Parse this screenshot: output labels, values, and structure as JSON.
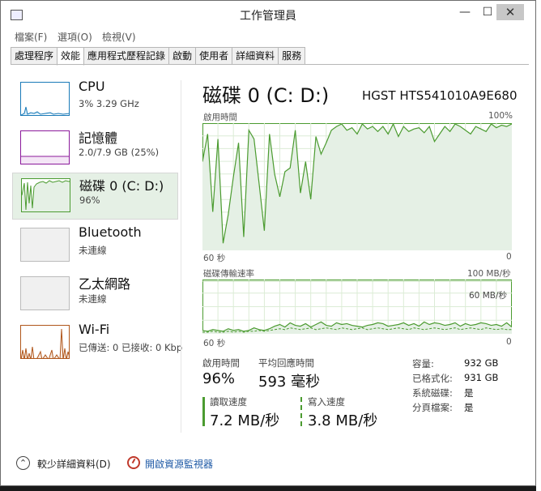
{
  "window": {
    "title": "工作管理員",
    "min": "—",
    "max": "☐",
    "close": "✕"
  },
  "menu": [
    "檔案(F)",
    "選項(O)",
    "檢視(V)"
  ],
  "tabs": [
    "處理程序",
    "效能",
    "應用程式歷程記錄",
    "啟動",
    "使用者",
    "詳細資料",
    "服務"
  ],
  "active_tab": 1,
  "sidebar": {
    "items": [
      {
        "title": "CPU",
        "sub": "3%  3.29 GHz",
        "color": "#1a7ab8"
      },
      {
        "title": "記憶體",
        "sub": "2.0/7.9 GB (25%)",
        "color": "#8b1a9b"
      },
      {
        "title": "磁碟 0 (C: D:)",
        "sub": "96%",
        "color": "#4b9b30"
      },
      {
        "title": "Bluetooth",
        "sub": "未連線",
        "color": "#999999"
      },
      {
        "title": "乙太網路",
        "sub": "未連線",
        "color": "#999999"
      },
      {
        "title": "Wi-Fi",
        "sub": "已傳送: 0 已接收: 0 Kbp",
        "color": "#b0561b"
      }
    ]
  },
  "disk": {
    "title": "磁碟 0 (C: D:)",
    "model": "HGST HTS541010A9E680",
    "active_chart": {
      "label": "啟用時間",
      "max_label": "100%",
      "x_left": "60 秒",
      "x_right": "0",
      "values": [
        70,
        92,
        30,
        88,
        5,
        28,
        58,
        85,
        10,
        95,
        88,
        52,
        15,
        92,
        60,
        42,
        62,
        65,
        95,
        45,
        70,
        40,
        90,
        76,
        85,
        95,
        98,
        100,
        95,
        97,
        92,
        100,
        96,
        98,
        94,
        98,
        92,
        100,
        90,
        98,
        94,
        96,
        97,
        93,
        98,
        86,
        92,
        98,
        94,
        100,
        98,
        95,
        92,
        98,
        96,
        94,
        100,
        97,
        99,
        98,
        100
      ]
    },
    "transfer_chart": {
      "label": "磁碟傳輸速率",
      "max_label": "100 MB/秒",
      "ref_label": "60 MB/秒",
      "x_left": "60 秒",
      "x_right": "0",
      "read_values": [
        3,
        2,
        4,
        3,
        2,
        5,
        3,
        4,
        2,
        3,
        6,
        4,
        3,
        5,
        8,
        10,
        7,
        12,
        9,
        8,
        11,
        7,
        10,
        13,
        9,
        8,
        12,
        10,
        11,
        9,
        8,
        7,
        9,
        10,
        12,
        11,
        8,
        9,
        10,
        12,
        9,
        11,
        8,
        13,
        10,
        12,
        11,
        9,
        10,
        12,
        8,
        11,
        9,
        10,
        12,
        11,
        9,
        10,
        8,
        12,
        7
      ],
      "write_values": [
        1,
        1,
        2,
        1,
        1,
        2,
        1,
        2,
        1,
        2,
        2,
        3,
        2,
        3,
        4,
        5,
        4,
        6,
        5,
        4,
        5,
        6,
        4,
        5,
        6,
        5,
        4,
        6,
        5,
        4,
        5,
        6,
        4,
        5,
        6,
        5,
        4,
        5,
        6,
        5,
        4,
        6,
        5,
        4,
        5,
        6,
        5,
        4,
        5,
        6,
        4,
        5,
        6,
        5,
        4,
        6,
        5,
        4,
        5,
        4,
        4
      ]
    },
    "stats": {
      "active_time_label": "啟用時間",
      "active_time": "96%",
      "avg_response_label": "平均回應時間",
      "avg_response": "593 毫秒",
      "read_label": "讀取速度",
      "read": "7.2 MB/秒",
      "write_label": "寫入速度",
      "write": "3.8 MB/秒"
    },
    "props": [
      {
        "k": "容量:",
        "v": "932 GB"
      },
      {
        "k": "已格式化:",
        "v": "931 GB"
      },
      {
        "k": "系統磁碟:",
        "v": "是"
      },
      {
        "k": "分頁檔案:",
        "v": "是"
      }
    ]
  },
  "footer": {
    "fewer_details": "較少詳細資料(D)",
    "open_resmon": "開啟資源監視器"
  },
  "accent": "#4b9b30"
}
